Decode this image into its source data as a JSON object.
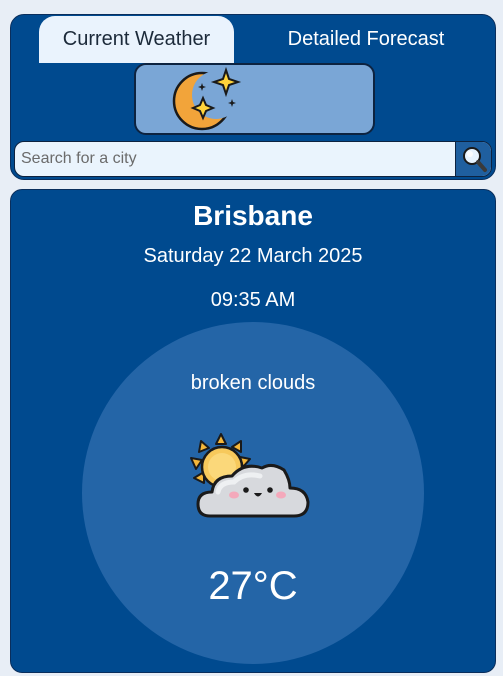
{
  "tabs": [
    {
      "label": "Current Weather",
      "active": true
    },
    {
      "label": "Detailed Forecast",
      "active": false
    }
  ],
  "logo": {
    "icon": "moon-stars-icon"
  },
  "search": {
    "placeholder": "Search for a city",
    "value": "",
    "button_icon": "magnifier-icon"
  },
  "weather": {
    "city": "Brisbane",
    "date": "Saturday 22 March 2025",
    "time": "09:35 AM",
    "description": "broken clouds",
    "icon": "sun-behind-cloud-icon",
    "temperature": "27°C"
  },
  "colors": {
    "panel": "#004a8f",
    "circle": "#2465a7",
    "logo_bg": "#7aa6d6",
    "active_tab": "#eaf3fd"
  }
}
